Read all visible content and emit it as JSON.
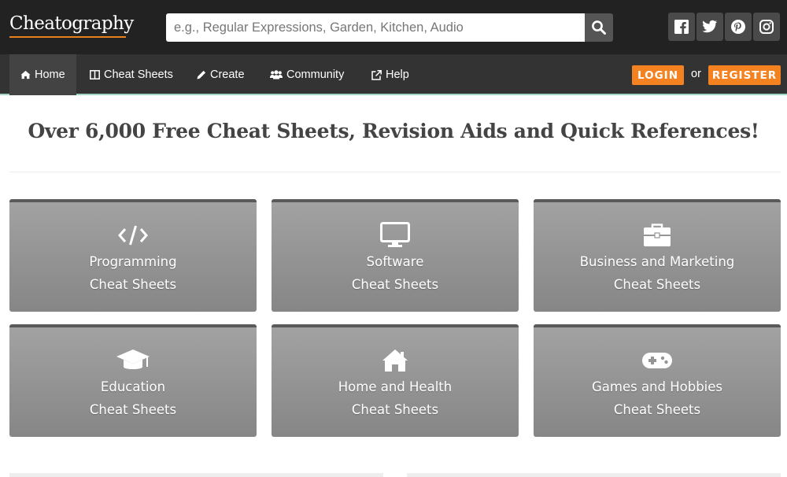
{
  "header": {
    "logo": "Cheatography",
    "search_placeholder": "e.g., Regular Expressions, Garden, Kitchen, Audio",
    "social": [
      "facebook-icon",
      "twitter-icon",
      "pinterest-icon",
      "instagram-icon"
    ]
  },
  "nav": {
    "items": [
      {
        "label": "Home",
        "icon": "home-icon"
      },
      {
        "label": "Cheat Sheets",
        "icon": "columns-icon"
      },
      {
        "label": "Create",
        "icon": "pencil-icon"
      },
      {
        "label": "Community",
        "icon": "users-icon"
      },
      {
        "label": "Help",
        "icon": "external-link-icon"
      }
    ],
    "login": "LOGIN",
    "or": "or",
    "register": "REGISTER"
  },
  "headline": "Over 6,000 Free Cheat Sheets, Revision Aids and Quick References!",
  "categories": [
    {
      "title": "Programming",
      "sub": "Cheat Sheets",
      "icon": "code-icon"
    },
    {
      "title": "Software",
      "sub": "Cheat Sheets",
      "icon": "monitor-icon"
    },
    {
      "title": "Business and Marketing",
      "sub": "Cheat Sheets",
      "icon": "briefcase-icon"
    },
    {
      "title": "Education",
      "sub": "Cheat Sheets",
      "icon": "graduation-cap-icon"
    },
    {
      "title": "Home and Health",
      "sub": "Cheat Sheets",
      "icon": "house-icon"
    },
    {
      "title": "Games and Hobbies",
      "sub": "Cheat Sheets",
      "icon": "gamepad-icon"
    }
  ],
  "colors": {
    "header_bg": "#222222",
    "nav_bg": "#333333",
    "accent": "#f58220",
    "card_bg": "#959595"
  }
}
